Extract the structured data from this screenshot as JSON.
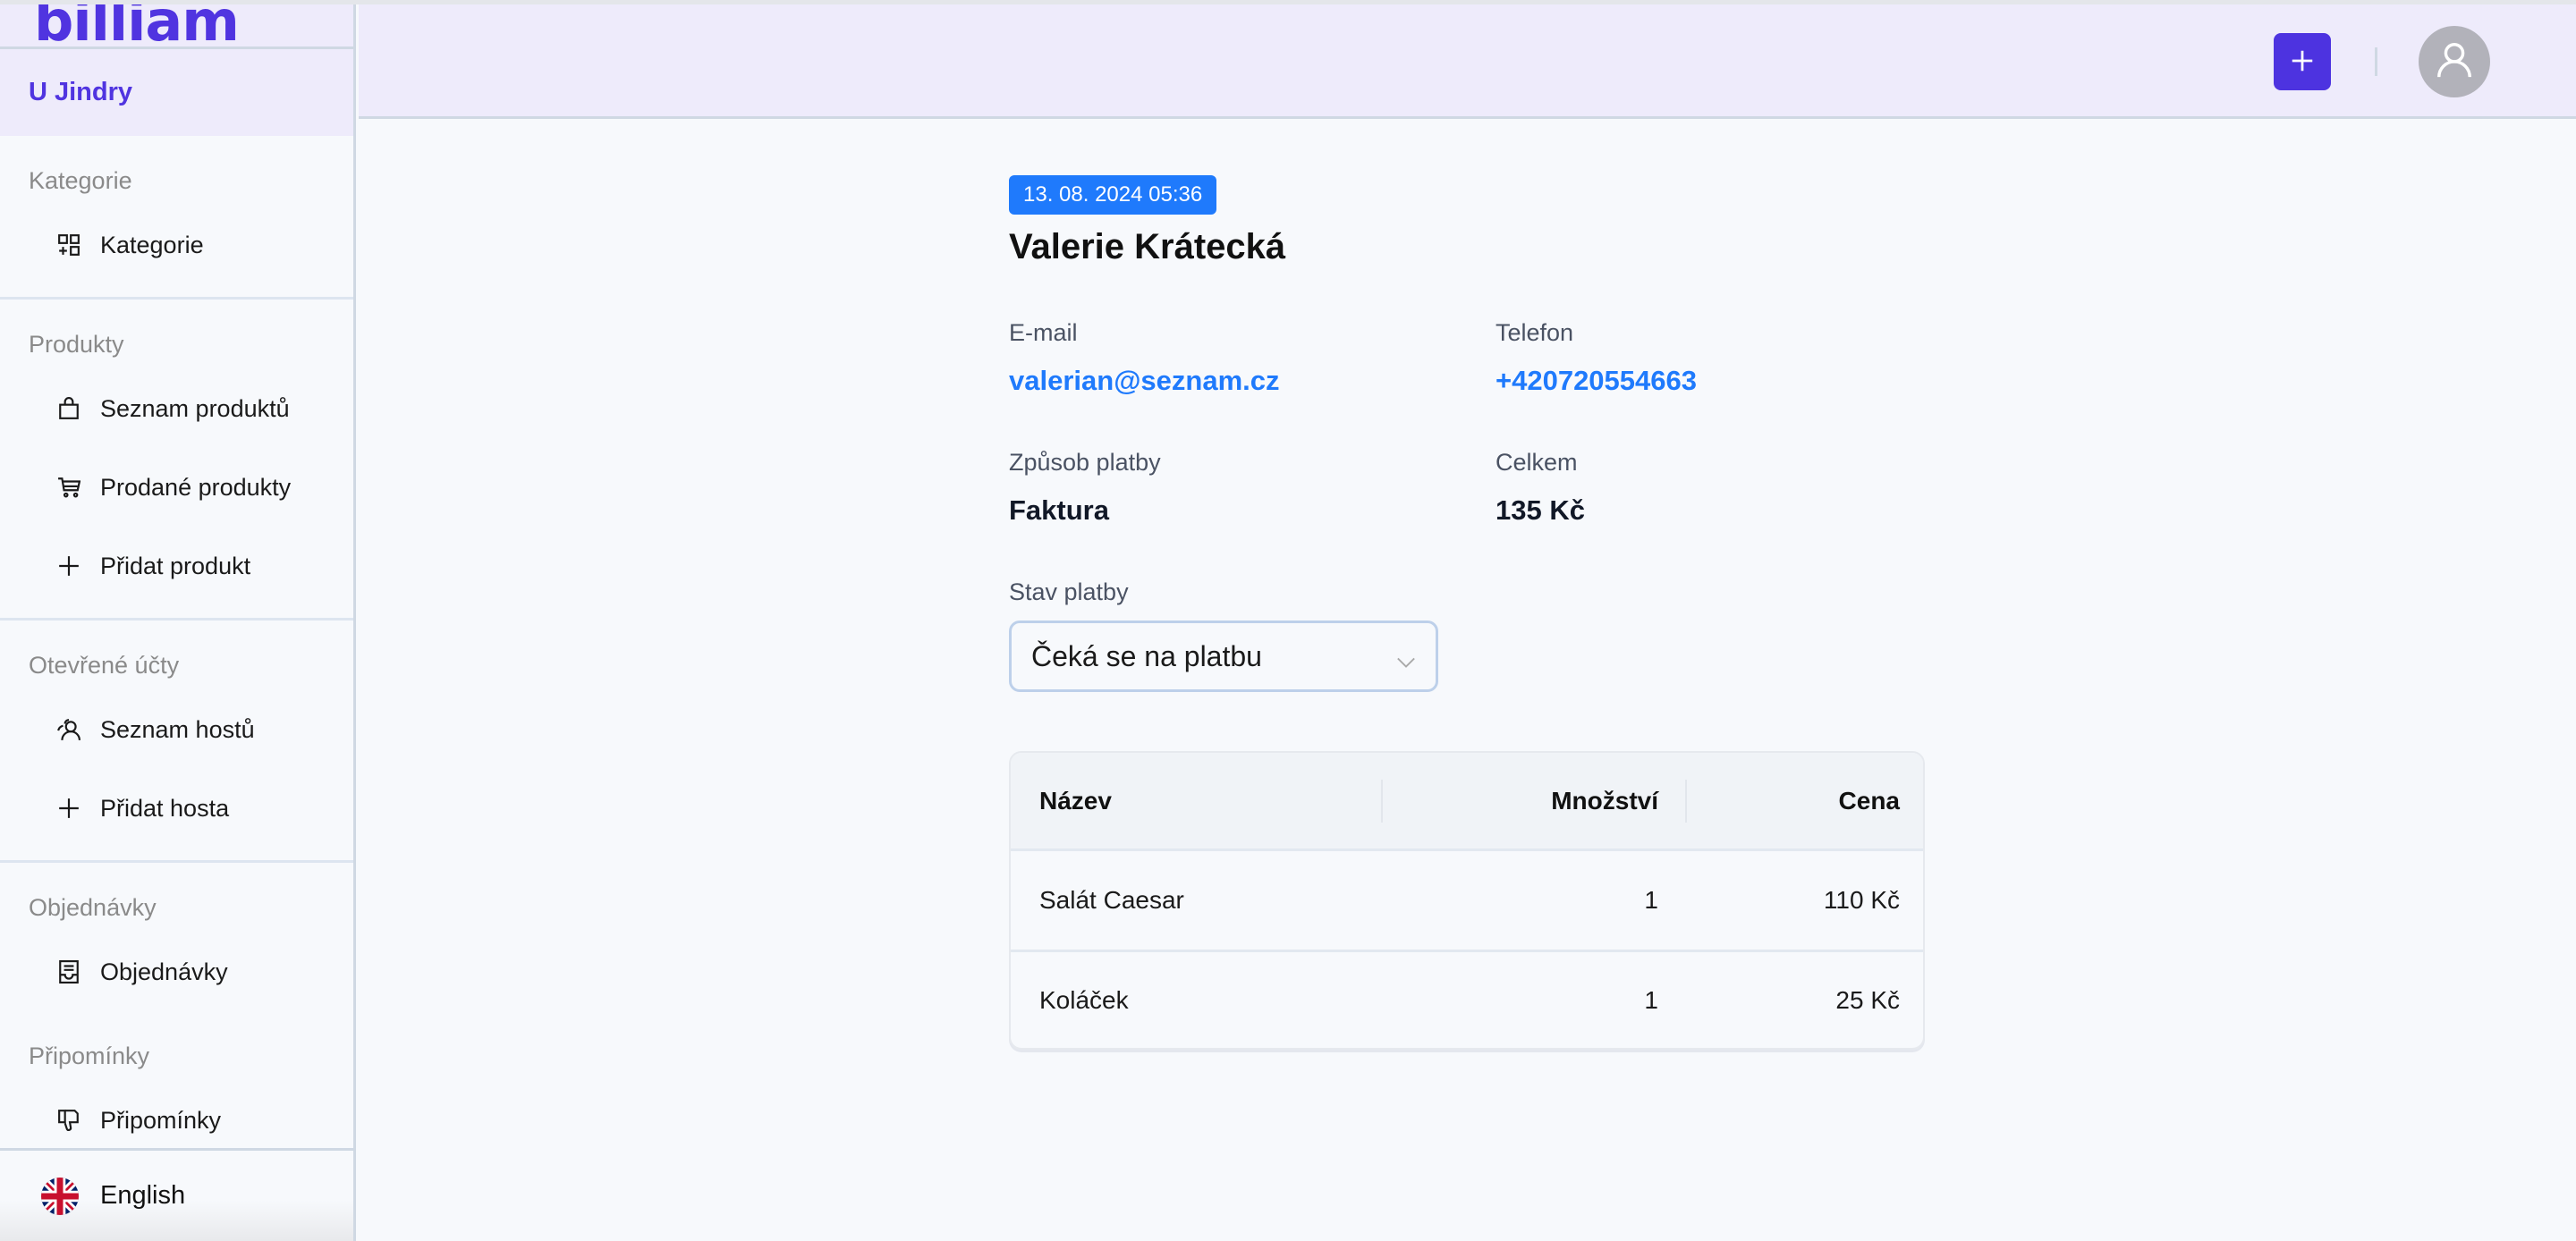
{
  "app": {
    "logo": "billiam",
    "venue": "U Jindry"
  },
  "sidebar": {
    "sections": [
      {
        "title": "Kategorie",
        "items": [
          {
            "label": "Kategorie",
            "icon": "category-add-icon"
          }
        ]
      },
      {
        "title": "Produkty",
        "items": [
          {
            "label": "Seznam produktů",
            "icon": "shopping-bag-icon"
          },
          {
            "label": "Prodané produkty",
            "icon": "cart-icon"
          },
          {
            "label": "Přidat produkt",
            "icon": "plus-icon"
          }
        ]
      },
      {
        "title": "Otevřené účty",
        "items": [
          {
            "label": "Seznam hostů",
            "icon": "users-icon"
          },
          {
            "label": "Přidat hosta",
            "icon": "plus-icon"
          }
        ]
      },
      {
        "title": "Objednávky",
        "items": [
          {
            "label": "Objednávky",
            "icon": "receipt-icon"
          }
        ]
      },
      {
        "title": "Připomínky",
        "items": [
          {
            "label": "Připomínky",
            "icon": "thumbs-down-icon"
          }
        ]
      }
    ],
    "language": {
      "label": "English",
      "icon": "uk-flag-icon"
    }
  },
  "header": {
    "add_button_icon": "plus-icon",
    "avatar_icon": "user-icon"
  },
  "order": {
    "date": "13. 08. 2024 05:36",
    "customer_name": "Valerie Krátecká",
    "email_label": "E-mail",
    "email": "valerian@seznam.cz",
    "phone_label": "Telefon",
    "phone": "+420720554663",
    "payment_method_label": "Způsob platby",
    "payment_method": "Faktura",
    "total_label": "Celkem",
    "total": "135 Kč",
    "payment_status_label": "Stav platby",
    "payment_status": "Čeká se na platbu"
  },
  "table": {
    "columns": [
      "Název",
      "Množství",
      "Cena"
    ],
    "rows": [
      {
        "name": "Salát Caesar",
        "quantity": "1",
        "price": "110 Kč"
      },
      {
        "name": "Koláček",
        "quantity": "1",
        "price": "25 Kč"
      }
    ]
  },
  "colors": {
    "brand": "#4d33e0",
    "link": "#1f7afc",
    "header_bg": "#eeebfb"
  }
}
